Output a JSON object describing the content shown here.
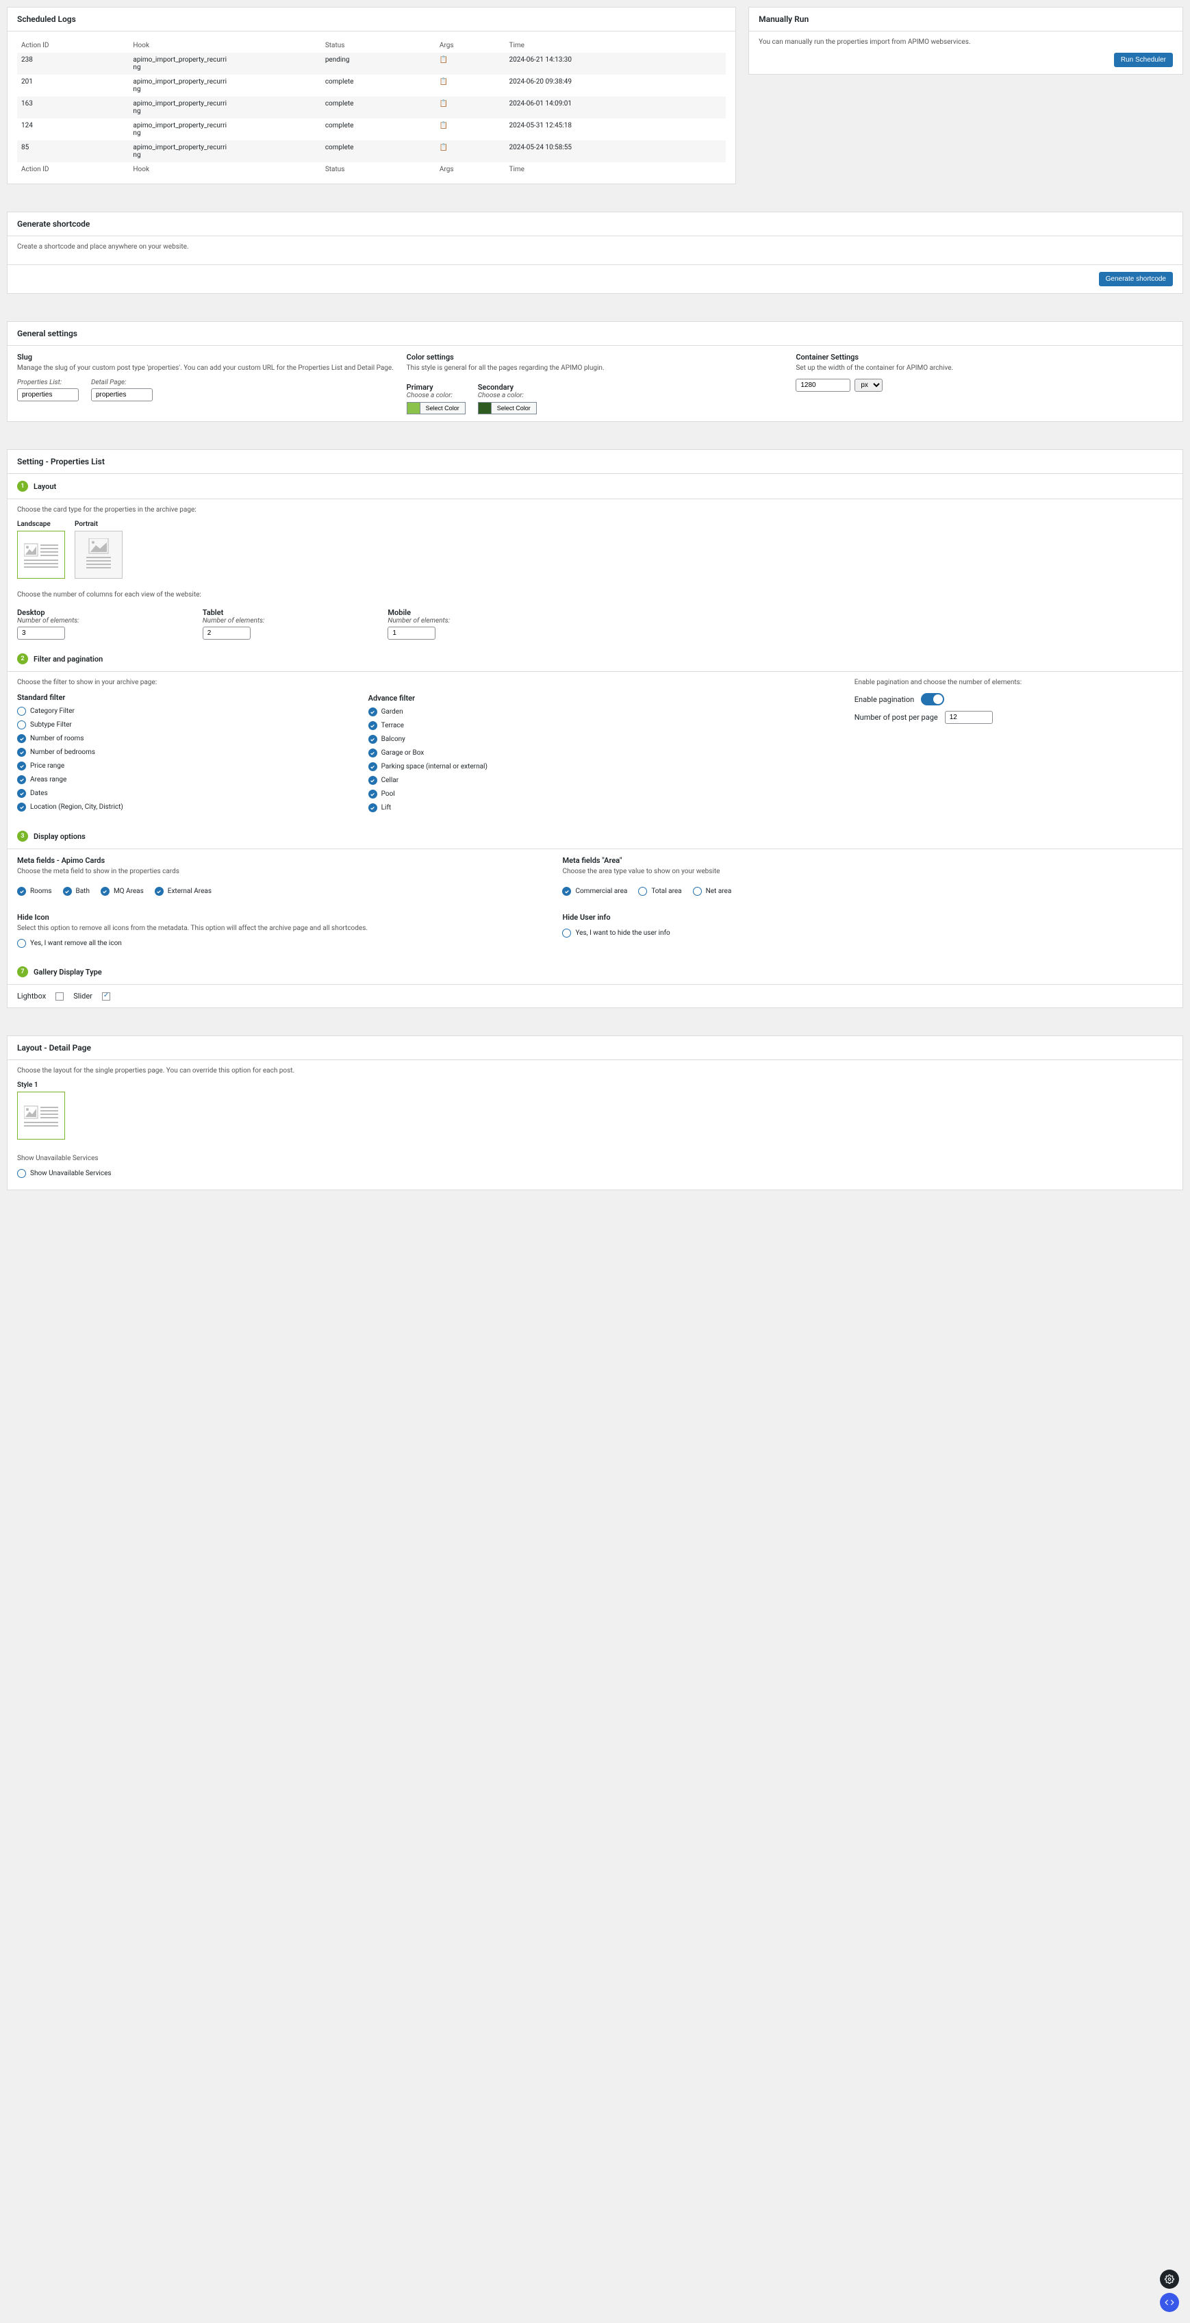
{
  "logs": {
    "title": "Scheduled Logs",
    "headers": {
      "id": "Action ID",
      "hook": "Hook",
      "status": "Status",
      "args": "Args",
      "time": "Time"
    },
    "rows": [
      {
        "id": "238",
        "hook": "apimo_import_property_recurring",
        "status": "pending",
        "time": "2024-06-21 14:13:30"
      },
      {
        "id": "201",
        "hook": "apimo_import_property_recurring",
        "status": "complete",
        "time": "2024-06-20 09:38:49"
      },
      {
        "id": "163",
        "hook": "apimo_import_property_recurring",
        "status": "complete",
        "time": "2024-06-01 14:09:01"
      },
      {
        "id": "124",
        "hook": "apimo_import_property_recurring",
        "status": "complete",
        "time": "2024-05-31 12:45:18"
      },
      {
        "id": "85",
        "hook": "apimo_import_property_recurring",
        "status": "complete",
        "time": "2024-05-24 10:58:55"
      }
    ]
  },
  "manual": {
    "title": "Manually Run",
    "desc": "You can manually run the properties import from APIMO webservices.",
    "btn": "Run Scheduler"
  },
  "shortcode": {
    "title": "Generate shortcode",
    "desc": "Create a shortcode and place anywhere on your website.",
    "btn": "Generate shortcode"
  },
  "general": {
    "title": "General settings",
    "slug": {
      "title": "Slug",
      "desc": "Manage the slug of your custom post type 'properties'. You can add your custom URL for the Properties List and Detail Page.",
      "list_lbl": "Properties List:",
      "list_val": "properties",
      "detail_lbl": "Detail Page:",
      "detail_val": "properties"
    },
    "color": {
      "title": "Color settings",
      "desc": "This style is general for all the pages regarding the APIMO plugin.",
      "primary": "Primary",
      "secondary": "Secondary",
      "choose": "Choose a color:",
      "select": "Select Color"
    },
    "container": {
      "title": "Container Settings",
      "desc": "Set up the width of the container for APIMO archive.",
      "val": "1280",
      "unit": "px"
    }
  },
  "propList": {
    "title": "Setting - Properties List",
    "step1": "Layout",
    "step1_desc": "Choose the card type for the properties in the archive page:",
    "landscape": "Landscape",
    "portrait": "Portrait",
    "cols_desc": "Choose the number of columns for each view of the website:",
    "desktop": "Desktop",
    "tablet": "Tablet",
    "mobile": "Mobile",
    "num_lbl": "Number of elements:",
    "d_val": "3",
    "t_val": "2",
    "m_val": "1",
    "step2": "Filter and pagination",
    "filter_desc": "Choose the filter to show in your archive page:",
    "std_title": "Standard filter",
    "adv_title": "Advance filter",
    "std": [
      "Category Filter",
      "Subtype Filter",
      "Number of rooms",
      "Number of bedrooms",
      "Price range",
      "Areas range",
      "Dates",
      "Location (Region, City, District)"
    ],
    "std_checked": [
      false,
      false,
      true,
      true,
      true,
      true,
      true,
      true
    ],
    "adv": [
      "Garden",
      "Terrace",
      "Balcony",
      "Garage or Box",
      "Parking space (internal or external)",
      "Cellar",
      "Pool",
      "Lift"
    ],
    "pag_desc": "Enable pagination and choose the number of elements:",
    "pag_enable": "Enable pagination",
    "pag_num_lbl": "Number of post per page",
    "pag_num": "12",
    "step3": "Display options",
    "meta_title": "Meta fields - Apimo Cards",
    "meta_desc": "Choose the meta field to show in the properties cards",
    "meta_items": [
      "Rooms",
      "Bath",
      "MQ Areas",
      "External Areas"
    ],
    "area_title": "Meta fields \"Area\"",
    "area_desc": "Choose the area type value to show on your website",
    "area_items": [
      "Commercial area",
      "Total area",
      "Net area"
    ],
    "area_checked": [
      true,
      false,
      false
    ],
    "hide_icon_title": "Hide Icon",
    "hide_icon_desc": "Select this option to remove all icons from the metadata. This option will affect the archive page and all shortcodes.",
    "hide_icon_opt": "Yes, I want remove all the icon",
    "hide_user_title": "Hide User info",
    "hide_user_opt": "Yes, I want to hide the user info",
    "step7": "Gallery Display Type",
    "lightbox": "Lightbox",
    "slider": "Slider"
  },
  "detail": {
    "title": "Layout - Detail Page",
    "desc": "Choose the layout for the single properties page. You can override this option for each post.",
    "style1": "Style 1",
    "unavail_lbl": "Show Unavailable Services",
    "unavail_opt": "Show Unavailable Services"
  },
  "nums": {
    "n1": "1",
    "n2": "2",
    "n3": "3",
    "n7": "7"
  }
}
